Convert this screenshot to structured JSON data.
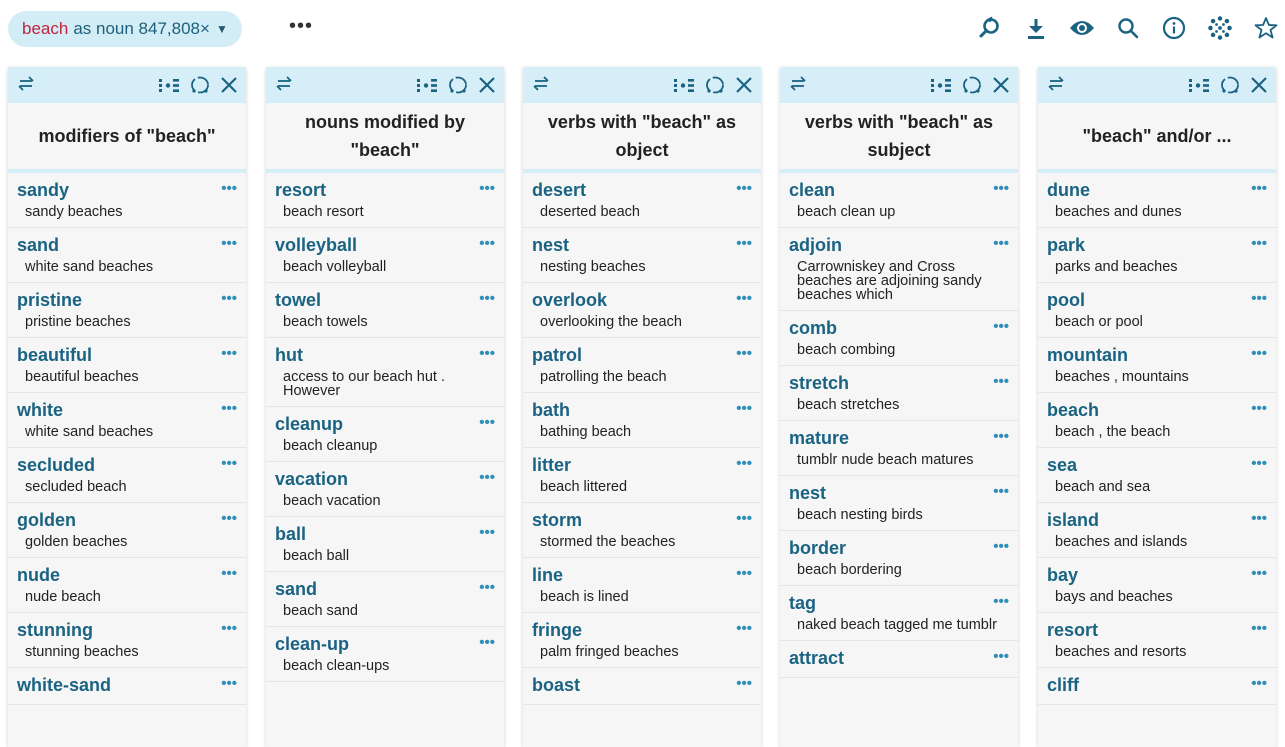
{
  "query": {
    "keyword": "beach",
    "rest": "as noun 847,808×",
    "caret": "▼"
  },
  "more_label": "•••",
  "toolbar_icons": [
    "zoom-reset-icon",
    "download-icon",
    "eye-icon",
    "search-icon",
    "info-icon",
    "dots-cluster-icon",
    "star-icon"
  ],
  "columns": [
    {
      "title": "modifiers of \"beach\"",
      "rows": [
        {
          "word": "sandy",
          "example": "sandy beaches"
        },
        {
          "word": "sand",
          "example": "white sand beaches"
        },
        {
          "word": "pristine",
          "example": "pristine beaches"
        },
        {
          "word": "beautiful",
          "example": "beautiful beaches"
        },
        {
          "word": "white",
          "example": "white sand beaches"
        },
        {
          "word": "secluded",
          "example": "secluded beach"
        },
        {
          "word": "golden",
          "example": "golden beaches"
        },
        {
          "word": "nude",
          "example": "nude beach"
        },
        {
          "word": "stunning",
          "example": "stunning beaches"
        },
        {
          "word": "white-sand",
          "example": ""
        }
      ]
    },
    {
      "title": "nouns modified by \"beach\"",
      "rows": [
        {
          "word": "resort",
          "example": "beach resort"
        },
        {
          "word": "volleyball",
          "example": "beach volleyball"
        },
        {
          "word": "towel",
          "example": "beach towels"
        },
        {
          "word": "hut",
          "example": "access to our beach hut . However"
        },
        {
          "word": "cleanup",
          "example": "beach cleanup"
        },
        {
          "word": "vacation",
          "example": "beach vacation"
        },
        {
          "word": "ball",
          "example": "beach ball"
        },
        {
          "word": "sand",
          "example": "beach sand"
        },
        {
          "word": "clean-up",
          "example": "beach clean-ups"
        }
      ]
    },
    {
      "title": "verbs with \"beach\" as object",
      "rows": [
        {
          "word": "desert",
          "example": "deserted beach"
        },
        {
          "word": "nest",
          "example": "nesting beaches"
        },
        {
          "word": "overlook",
          "example": "overlooking the beach"
        },
        {
          "word": "patrol",
          "example": "patrolling the beach"
        },
        {
          "word": "bath",
          "example": "bathing beach"
        },
        {
          "word": "litter",
          "example": "beach littered"
        },
        {
          "word": "storm",
          "example": "stormed the beaches"
        },
        {
          "word": "line",
          "example": "beach is lined"
        },
        {
          "word": "fringe",
          "example": "palm fringed beaches"
        },
        {
          "word": "boast",
          "example": ""
        }
      ]
    },
    {
      "title": "verbs with \"beach\" as subject",
      "rows": [
        {
          "word": "clean",
          "example": "beach clean up"
        },
        {
          "word": "adjoin",
          "example": "Carrowniskey and Cross beaches are adjoining sandy beaches which"
        },
        {
          "word": "comb",
          "example": "beach combing"
        },
        {
          "word": "stretch",
          "example": "beach stretches"
        },
        {
          "word": "mature",
          "example": "tumblr nude beach matures"
        },
        {
          "word": "nest",
          "example": "beach nesting birds"
        },
        {
          "word": "border",
          "example": "beach bordering"
        },
        {
          "word": "tag",
          "example": "naked beach tagged me tumblr"
        },
        {
          "word": "attract",
          "example": ""
        }
      ]
    },
    {
      "title": "\"beach\" and/or ...",
      "rows": [
        {
          "word": "dune",
          "example": "beaches and dunes"
        },
        {
          "word": "park",
          "example": "parks and beaches"
        },
        {
          "word": "pool",
          "example": "beach or pool"
        },
        {
          "word": "mountain",
          "example": "beaches , mountains"
        },
        {
          "word": "beach",
          "example": "beach , the beach"
        },
        {
          "word": "sea",
          "example": "beach and sea"
        },
        {
          "word": "island",
          "example": "beaches and islands"
        },
        {
          "word": "bay",
          "example": "bays and beaches"
        },
        {
          "word": "resort",
          "example": "beaches and resorts"
        },
        {
          "word": "cliff",
          "example": ""
        }
      ]
    }
  ],
  "row_menu_label": "•••",
  "colors": {
    "accent": "#1a6382",
    "header_bg": "#d6eef7",
    "keyword": "#c2233c",
    "dots": "#2f8fb9"
  }
}
